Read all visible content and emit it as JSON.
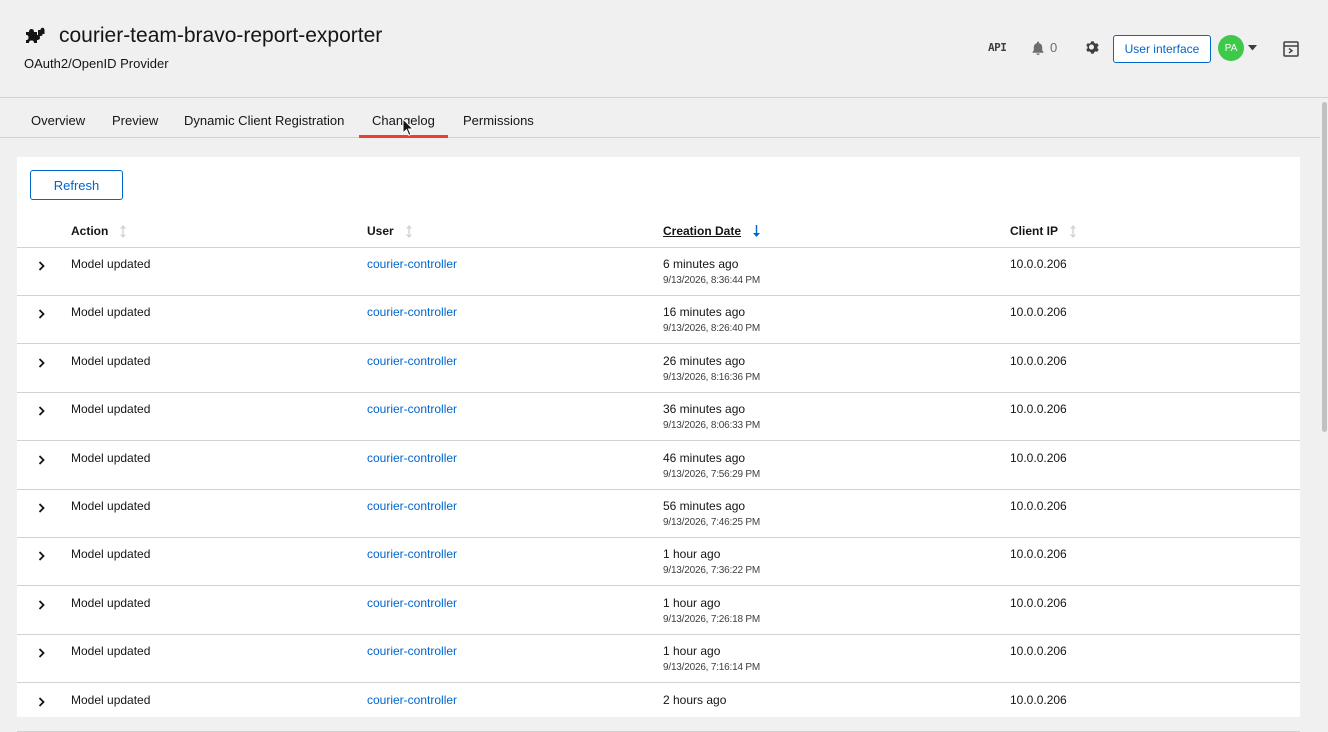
{
  "header": {
    "title": "courier-team-bravo-report-exporter",
    "subtitle": "OAuth2/OpenID Provider",
    "api_label": "API",
    "notification_count": "0",
    "user_interface_label": "User interface",
    "avatar_initials": "PA"
  },
  "tabs": [
    {
      "label": "Overview",
      "active": false
    },
    {
      "label": "Preview",
      "active": false
    },
    {
      "label": "Dynamic Client Registration",
      "active": false
    },
    {
      "label": "Changelog",
      "active": true
    },
    {
      "label": "Permissions",
      "active": false
    }
  ],
  "toolbar": {
    "refresh_label": "Refresh"
  },
  "table": {
    "columns": [
      {
        "label": "Action",
        "sortable": true,
        "sorted": false
      },
      {
        "label": "User",
        "sortable": true,
        "sorted": false
      },
      {
        "label": "Creation Date",
        "sortable": true,
        "sorted": true,
        "direction": "desc"
      },
      {
        "label": "Client IP",
        "sortable": true,
        "sorted": false
      }
    ],
    "rows": [
      {
        "action": "Model updated",
        "user": "courier-controller",
        "relative": "6 minutes ago",
        "absolute": "9/13/2026, 8:36:44 PM",
        "ip": "10.0.0.206"
      },
      {
        "action": "Model updated",
        "user": "courier-controller",
        "relative": "16 minutes ago",
        "absolute": "9/13/2026, 8:26:40 PM",
        "ip": "10.0.0.206"
      },
      {
        "action": "Model updated",
        "user": "courier-controller",
        "relative": "26 minutes ago",
        "absolute": "9/13/2026, 8:16:36 PM",
        "ip": "10.0.0.206"
      },
      {
        "action": "Model updated",
        "user": "courier-controller",
        "relative": "36 minutes ago",
        "absolute": "9/13/2026, 8:06:33 PM",
        "ip": "10.0.0.206"
      },
      {
        "action": "Model updated",
        "user": "courier-controller",
        "relative": "46 minutes ago",
        "absolute": "9/13/2026, 7:56:29 PM",
        "ip": "10.0.0.206"
      },
      {
        "action": "Model updated",
        "user": "courier-controller",
        "relative": "56 minutes ago",
        "absolute": "9/13/2026, 7:46:25 PM",
        "ip": "10.0.0.206"
      },
      {
        "action": "Model updated",
        "user": "courier-controller",
        "relative": "1 hour ago",
        "absolute": "9/13/2026, 7:36:22 PM",
        "ip": "10.0.0.206"
      },
      {
        "action": "Model updated",
        "user": "courier-controller",
        "relative": "1 hour ago",
        "absolute": "9/13/2026, 7:26:18 PM",
        "ip": "10.0.0.206"
      },
      {
        "action": "Model updated",
        "user": "courier-controller",
        "relative": "1 hour ago",
        "absolute": "9/13/2026, 7:16:14 PM",
        "ip": "10.0.0.206"
      },
      {
        "action": "Model updated",
        "user": "courier-controller",
        "relative": "2 hours ago",
        "absolute": "",
        "ip": "10.0.0.206"
      }
    ]
  },
  "colors": {
    "accent": "#0066cc",
    "active_tab_indicator": "#ee3e2d",
    "avatar_bg": "#3ec94a"
  }
}
